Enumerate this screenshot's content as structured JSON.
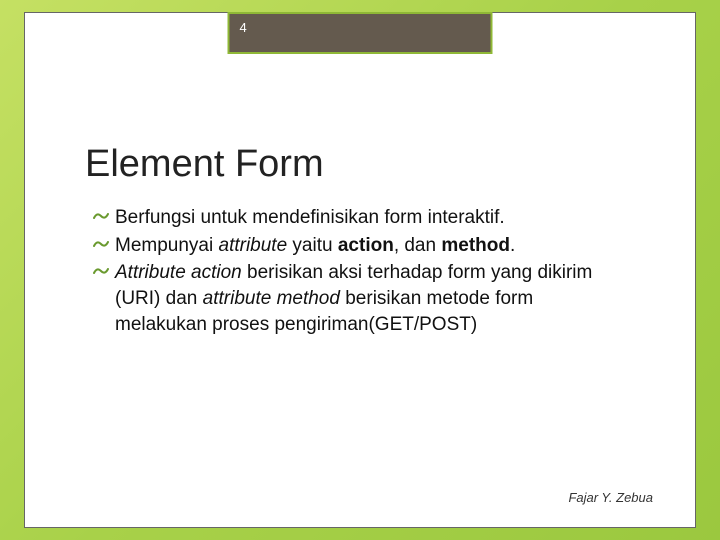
{
  "page_number": "4",
  "title": "Element Form",
  "bullets": {
    "b1": {
      "t1": "Berfungsi untuk mendefinisikan form interaktif."
    },
    "b2": {
      "t1": "Mempunyai ",
      "attr": "attribute",
      "t2": " yaitu ",
      "action": "action",
      "t3": ", dan ",
      "method": "method",
      "t4": "."
    },
    "b3": {
      "attr": "Attribute",
      "t1": " ",
      "action": "action",
      "t2": " berisikan aksi terhadap form yang dikirim (URI) dan ",
      "attrmethod": "attribute method",
      "t3": " berisikan metode form melakukan proses pengiriman(GET/POST)"
    }
  },
  "footer": "Fajar Y. Zebua"
}
